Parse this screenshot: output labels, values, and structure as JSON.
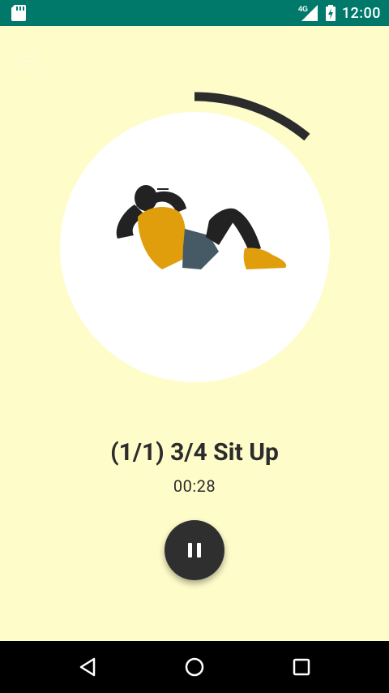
{
  "status_bar": {
    "time": "12:00",
    "network": "4G",
    "icons": [
      "sd-card-icon",
      "signal-icon",
      "battery-icon"
    ],
    "bg_color": "#00796b"
  },
  "exercise": {
    "title": "(1/1) 3/4 Sit Up",
    "timer": "00:28",
    "progress_fraction": 0.11,
    "icon": "sit-up-illustration"
  },
  "controls": {
    "pause_icon": "pause-icon"
  },
  "nav_bar": {
    "icons": [
      "back-icon",
      "home-icon",
      "recents-icon"
    ]
  },
  "colors": {
    "background": "#fefcc9",
    "circle": "#ffffff",
    "accent_shirt": "#e09e0c",
    "shorts": "#455a64",
    "ring": "#2c2c2c"
  }
}
